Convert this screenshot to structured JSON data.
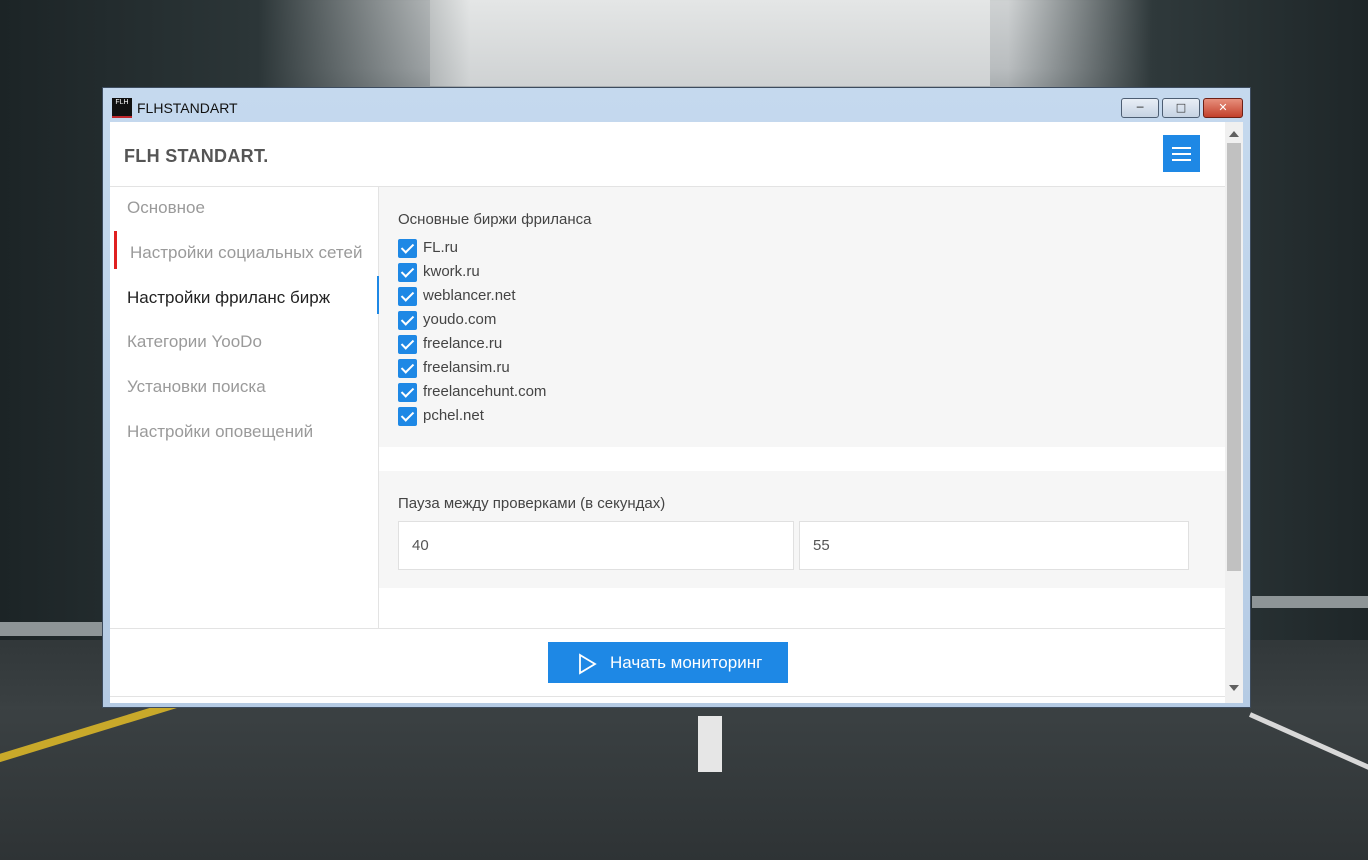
{
  "window": {
    "title": "FLHSTANDART",
    "icon_text": "FLH"
  },
  "header": {
    "brand": "FLH STANDART.",
    "menu_icon": "hamburger-icon",
    "accent": "#1e88e5"
  },
  "sidebar": {
    "items": [
      {
        "label": "Основное"
      },
      {
        "label": "Настройки социальных сетей"
      },
      {
        "label": "Настройки фриланс бирж"
      },
      {
        "label": "Категории YooDo"
      },
      {
        "label": "Установки поиска"
      },
      {
        "label": "Настройки оповещений"
      }
    ]
  },
  "exchanges": {
    "title": "Основные биржи фриланса",
    "items": [
      {
        "label": "FL.ru",
        "checked": true
      },
      {
        "label": "kwork.ru",
        "checked": true
      },
      {
        "label": "weblancer.net",
        "checked": true
      },
      {
        "label": "youdo.com",
        "checked": true
      },
      {
        "label": "freelance.ru",
        "checked": true
      },
      {
        "label": "freelansim.ru",
        "checked": true
      },
      {
        "label": "freelancehunt.com",
        "checked": true
      },
      {
        "label": "pchel.net",
        "checked": true
      }
    ]
  },
  "pause": {
    "title": "Пауза между проверками (в секундах)",
    "min_value": "40",
    "max_value": "55"
  },
  "footer": {
    "start_label": "Начать мониторинг",
    "start_icon": "play-icon"
  }
}
